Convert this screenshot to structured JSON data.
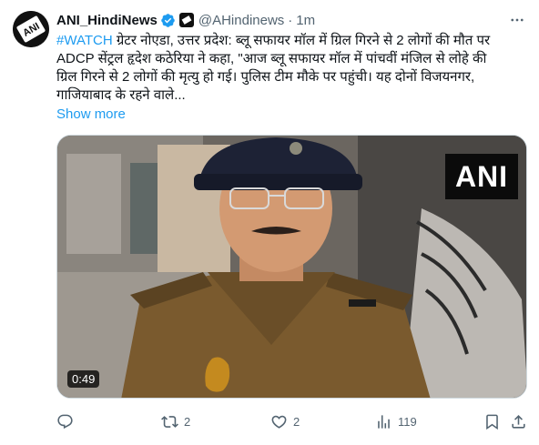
{
  "tweet": {
    "author_name": "ANI_HindiNews",
    "handle": "@AHindinews",
    "separator": "·",
    "time": "1m",
    "avatar_text": "ANI",
    "hashtag": "#WATCH",
    "text_line1": " ग्रेटर नोएडा, उत्तर प्रदेश: ब्लू सफायर मॉल में ग्रिल गिरने से 2 लोगों की मौत पर",
    "text_line2": "ADCP सेंट्रल हृदेश कठेरिया ने कहा, \"आज ब्लू सफायर मॉल में पांचवीं मंजिल से लोहे की",
    "text_line3": "ग्रिल गिरने से 2 लोगों की मृत्यु हो गई। पुलिस टीम मौके पर पहुंची। यह दोनों विजयनगर,",
    "text_line4": "गाजियाबाद के रहने वाले...",
    "show_more": "Show more"
  },
  "media": {
    "watermark": "ANI",
    "duration": "0:49"
  },
  "actions": {
    "reply_count": "",
    "retweet_count": "2",
    "like_count": "2",
    "views_count": "119"
  },
  "colors": {
    "link": "#1d9bf0",
    "secondary_text": "#536471",
    "verified": "#1d9bf0"
  },
  "icons": [
    "more-icon",
    "verified-icon",
    "affiliate-icon",
    "reply-icon",
    "retweet-icon",
    "like-icon",
    "views-icon",
    "bookmark-icon",
    "share-icon"
  ]
}
